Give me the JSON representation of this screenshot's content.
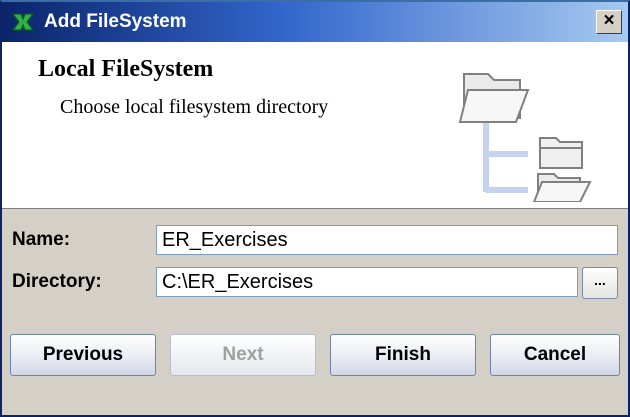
{
  "window": {
    "title": "Add FileSystem",
    "close_glyph": "×"
  },
  "header": {
    "title": "Local FileSystem",
    "subtitle": "Choose local filesystem directory",
    "illustration_icon": "folder-tree-icon"
  },
  "form": {
    "name_label": "Name:",
    "name_value": "ER_Exercises",
    "directory_label": "Directory:",
    "directory_value": "C:\\ER_Exercises",
    "browse_label": "..."
  },
  "buttons": {
    "previous": "Previous",
    "next": "Next",
    "finish": "Finish",
    "cancel": "Cancel"
  },
  "colors": {
    "title_bar_start": "#0a246a",
    "title_bar_end": "#a6caf0",
    "dialog_bg": "#d4d0c8",
    "header_bg": "#ffffff"
  }
}
